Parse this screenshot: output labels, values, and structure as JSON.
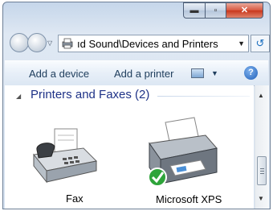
{
  "window": {
    "minimize_glyph": "▬",
    "maximize_glyph": "▫",
    "close_glyph": "✕"
  },
  "address": {
    "path": "ıd Sound\\Devices and Printers",
    "dropdown_glyph": "▼",
    "refresh_glyph": "↺"
  },
  "nav": {
    "history_glyph": "▽"
  },
  "toolbar": {
    "add_device": "Add a device",
    "add_printer": "Add a printer",
    "view_dropdown_glyph": "▼",
    "help_glyph": "?"
  },
  "group": {
    "arrow": "◢",
    "title": "Printers and Faxes (2)"
  },
  "devices": [
    {
      "label": "Fax",
      "icon": "fax-icon"
    },
    {
      "label": "Microsoft XPS",
      "icon": "printer-icon",
      "status": "default-printer-check"
    }
  ],
  "scrollbar": {
    "up": "▲",
    "down": "▼"
  },
  "colors": {
    "group_title": "#1e3287",
    "toolbar_text": "#1e3d5c",
    "close_red": "#c8361c"
  }
}
